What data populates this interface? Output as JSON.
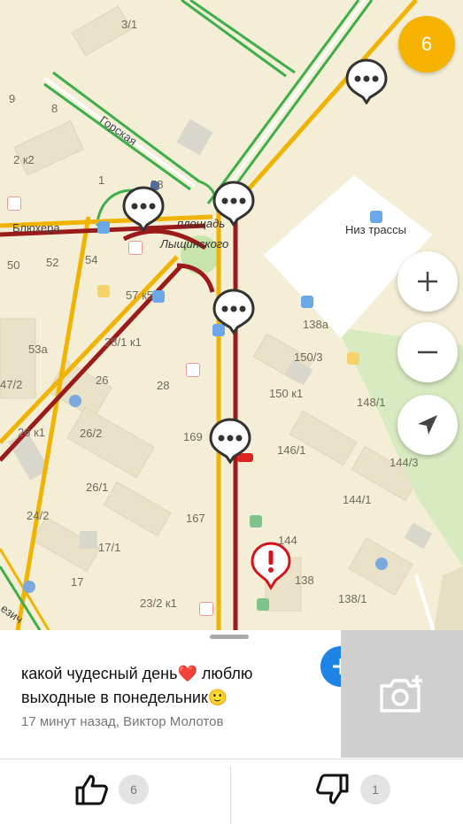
{
  "map": {
    "report_count": "6",
    "streets": {
      "gorskaya": "Горская",
      "blyukhera": "Блюхера",
      "plaza_line1": "площадь",
      "plaza_line2": "Лыщинского",
      "bottom_street": "езич"
    },
    "places": {
      "niz_trassy": "Низ трассы"
    },
    "house_numbers": {
      "n3_1": "3/1",
      "n9": "9",
      "n8": "8",
      "n2k2": "2 к2",
      "n1": "1",
      "n58": "58",
      "n50": "50",
      "n52": "52",
      "n54": "54",
      "n57k5": "57 к5",
      "n53a": "53а",
      "n28_1k1": "28/1 к1",
      "n47_2": "47/2",
      "n26": "26",
      "n28": "28",
      "n26k1": "26 к1",
      "n26_2": "26/2",
      "n169": "169",
      "n26_1": "26/1",
      "n24_2": "24/2",
      "n167": "167",
      "n17_1": "17/1",
      "n17": "17",
      "n23_2k1": "23/2 к1",
      "n138a": "138а",
      "n150_3": "150/3",
      "n150k1": "150 к1",
      "n148_1": "148/1",
      "n146_1": "146/1",
      "n144_3": "144/3",
      "n144_1": "144/1",
      "n144": "144",
      "n138": "138",
      "n138_1": "138/1"
    },
    "colors": {
      "jam": "#9b1b1b",
      "slow": "#f0b400",
      "free": "#3cae4a",
      "badge": "#f5b300",
      "alert": "#d4141b"
    }
  },
  "controls": {
    "zoom_in_icon": "plus-icon",
    "zoom_out_icon": "minus-icon",
    "locate_icon": "navigation-arrow-icon"
  },
  "post": {
    "text": "какой чудесный день❤️ люблю выходные в понедельник🙂",
    "meta": "17 минут назад, Виктор Молотов"
  },
  "votes": {
    "likes": "6",
    "dislikes": "1"
  }
}
